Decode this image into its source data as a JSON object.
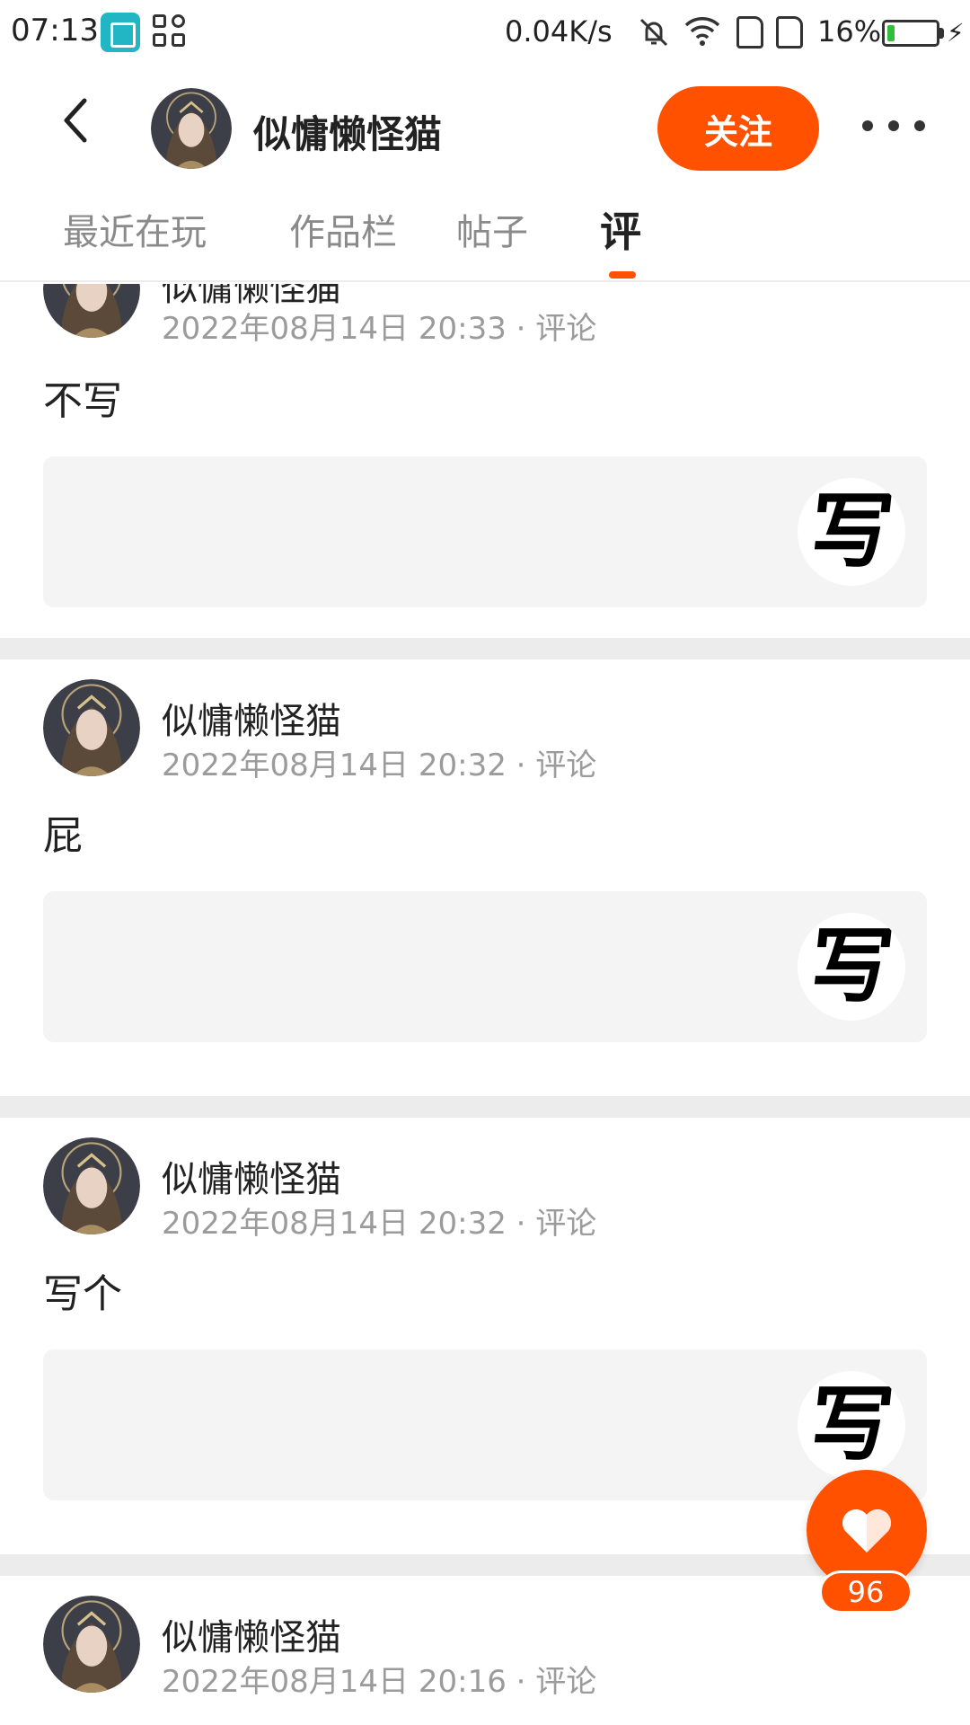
{
  "status_bar": {
    "time": "07:13",
    "net_speed": "0.04K/s",
    "battery_percent": "16%",
    "battery_level": 0.16,
    "battery_color": "#2fbf3a"
  },
  "header": {
    "username": "似慵懒怪猫",
    "follow_label": "关注",
    "accent_color": "#ff5100"
  },
  "tabs": [
    {
      "label": "最近在玩"
    },
    {
      "label": "作品栏"
    },
    {
      "label": "帖子"
    },
    {
      "label": "评",
      "active": true
    }
  ],
  "posts": [
    {
      "author": "似慵懒怪猫",
      "date": "2022年08月14日 20:33",
      "type": "评论",
      "text": "不写",
      "badge_glyph": "写"
    },
    {
      "author": "似慵懒怪猫",
      "date": "2022年08月14日 20:32",
      "type": "评论",
      "text": "屁",
      "badge_glyph": "写"
    },
    {
      "author": "似慵懒怪猫",
      "date": "2022年08月14日 20:32",
      "type": "评论",
      "text": "写个",
      "badge_glyph": "写"
    },
    {
      "author": "似慵懒怪猫",
      "date": "2022年08月14日 20:16",
      "type": "评论",
      "text": ""
    }
  ],
  "like": {
    "count": "96",
    "icon": "heart-icon"
  }
}
